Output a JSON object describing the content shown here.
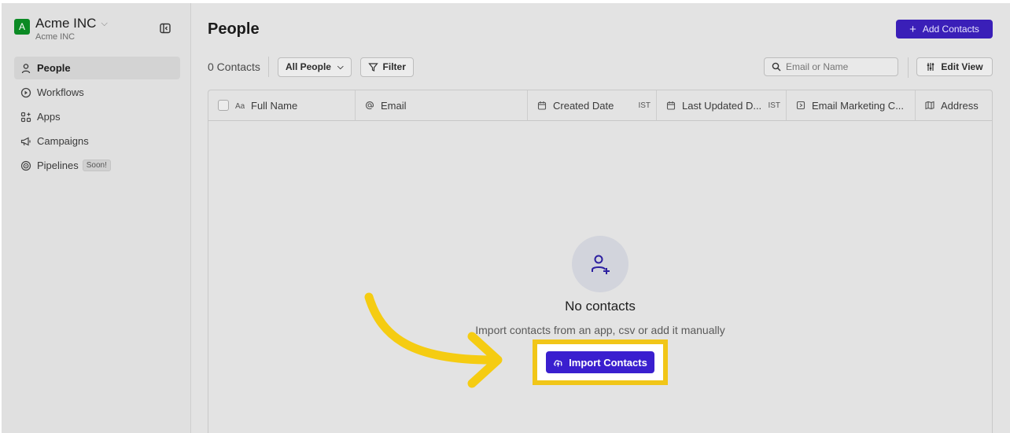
{
  "workspace": {
    "avatar": "A",
    "name": "Acme INC",
    "sub": "Acme INC"
  },
  "nav": [
    {
      "label": "People",
      "icon": "person-icon",
      "active": true
    },
    {
      "label": "Workflows",
      "icon": "workflow-icon"
    },
    {
      "label": "Apps",
      "icon": "apps-icon"
    },
    {
      "label": "Campaigns",
      "icon": "megaphone-icon"
    },
    {
      "label": "Pipelines",
      "icon": "target-icon",
      "badge": "Soon!"
    }
  ],
  "header": {
    "title": "People",
    "add_label": "Add Contacts"
  },
  "toolbar": {
    "count": "0 Contacts",
    "view": "All People",
    "filter": "Filter",
    "search_placeholder": "Email or Name",
    "edit_view": "Edit View"
  },
  "table": {
    "columns": [
      {
        "label": "Full Name",
        "icon": "text-icon"
      },
      {
        "label": "Email",
        "icon": "at-icon"
      },
      {
        "label": "Created Date",
        "icon": "calendar-icon",
        "tz": "IST"
      },
      {
        "label": "Last Updated D...",
        "icon": "calendar-icon",
        "tz": "IST"
      },
      {
        "label": "Email Marketing C...",
        "icon": "status-icon"
      },
      {
        "label": "Address",
        "icon": "map-icon"
      }
    ]
  },
  "empty": {
    "title": "No contacts",
    "subtitle": "Import contacts from an app, csv or add it manually",
    "import_label": "Import Contacts"
  },
  "colors": {
    "accent": "#3a1fcf",
    "highlight": "#f1c618",
    "workspace": "#0b8a24"
  }
}
